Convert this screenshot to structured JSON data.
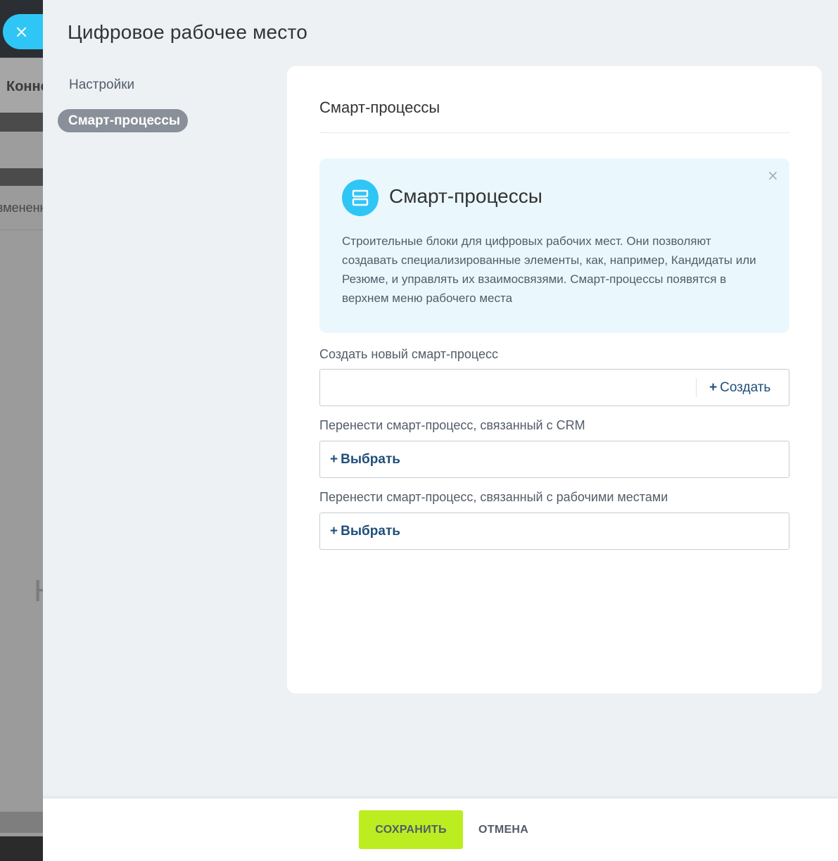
{
  "background": {
    "tab_text": "Конне",
    "row_text": "змененн",
    "big_letter": "Н"
  },
  "slider": {
    "close_glyph": "×",
    "title": "Цифровое рабочее место",
    "menu": [
      {
        "label": "Настройки",
        "active": false
      },
      {
        "label": "Смарт-процессы",
        "active": true
      }
    ]
  },
  "card": {
    "title": "Смарт-процессы",
    "info": {
      "icon": "smart-process-icon",
      "title": "Смарт-процессы",
      "close_glyph": "×",
      "text": "Строительные блоки для цифровых рабочих мест. Они позволяют создавать специализированные элементы, как, например, Кандидаты или Резюме, и управлять их взаимосвязями. Смарт-процессы появятся в верхнем меню рабочего места"
    },
    "create": {
      "label": "Создать новый смарт-процесс",
      "value": "",
      "placeholder": "",
      "button_plus": "+",
      "button_label": "Создать"
    },
    "crm_transfer": {
      "label": "Перенести смарт-процесс, связанный с CRM",
      "button_plus": "+",
      "button_label": "Выбрать"
    },
    "workplace_transfer": {
      "label": "Перенести смарт-процесс, связанный с рабочими местами",
      "button_plus": "+",
      "button_label": "Выбрать"
    }
  },
  "footer": {
    "save_label": "СОХРАНИТЬ",
    "cancel_label": "ОТМЕНА"
  },
  "colors": {
    "accent": "#2fc6f6",
    "save": "#bbed21",
    "link": "#1f4e7a"
  }
}
